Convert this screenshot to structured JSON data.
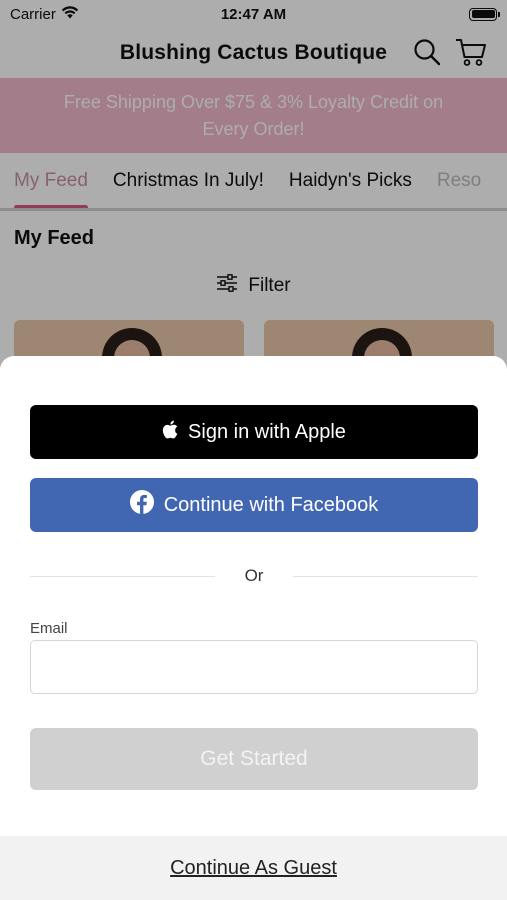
{
  "status_bar": {
    "carrier": "Carrier",
    "time": "12:47 AM"
  },
  "header": {
    "title": "Blushing Cactus Boutique",
    "search_icon": "search-icon",
    "cart_icon": "cart-icon"
  },
  "promo": {
    "text": "Free Shipping Over $75 & 3% Loyalty Credit on Every Order!",
    "color": "#f2b9cc"
  },
  "tabs": [
    {
      "label": "My Feed",
      "active": true
    },
    {
      "label": "Christmas In July!",
      "active": false
    },
    {
      "label": "Haidyn's Picks",
      "active": false
    },
    {
      "label": "Reso",
      "active": false
    }
  ],
  "feed": {
    "title": "My Feed",
    "filter_label": "Filter"
  },
  "sheet": {
    "apple_label": "Sign in with Apple",
    "facebook_label": "Continue with Facebook",
    "or_label": "Or",
    "email_label": "Email",
    "email_value": "",
    "email_placeholder": "",
    "get_started_label": "Get Started",
    "guest_label": "Continue As Guest"
  },
  "colors": {
    "accent": "#d45b86",
    "facebook": "#4267b2",
    "apple": "#000000",
    "disabled": "#d0d0d0"
  }
}
